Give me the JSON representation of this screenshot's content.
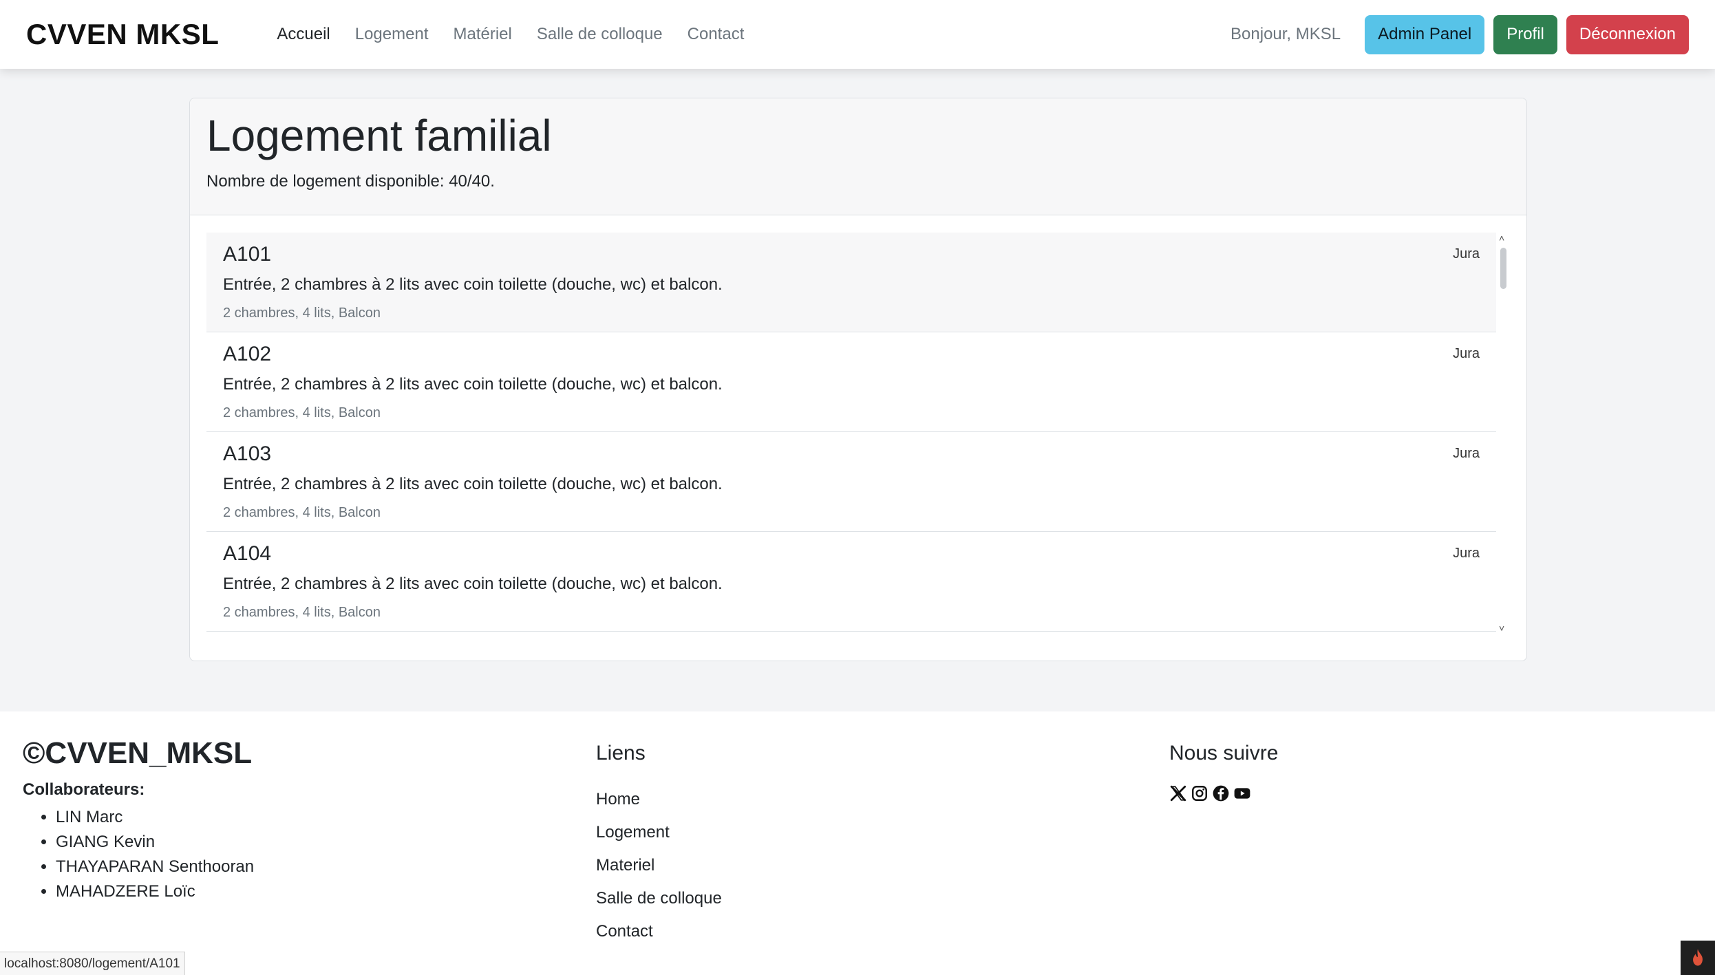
{
  "navbar": {
    "brand": "CVVEN MKSL",
    "links": [
      "Accueil",
      "Logement",
      "Matériel",
      "Salle de colloque",
      "Contact"
    ],
    "greeting": "Bonjour, MKSL",
    "admin_label": "Admin Panel",
    "profile_label": "Profil",
    "logout_label": "Déconnexion",
    "colors": {
      "admin": "#57c3e8",
      "profile": "#2f8050",
      "logout": "#d3414c"
    }
  },
  "main": {
    "title": "Logement familial",
    "availability": "Nombre de logement disponible: 40/40.",
    "items": [
      {
        "code": "A101",
        "description": "Entrée, 2 chambres à 2 lits avec coin toilette (douche, wc) et balcon.",
        "meta": "2 chambres, 4 lits, Balcon",
        "tag": "Jura"
      },
      {
        "code": "A102",
        "description": "Entrée, 2 chambres à 2 lits avec coin toilette (douche, wc) et balcon.",
        "meta": "2 chambres, 4 lits, Balcon",
        "tag": "Jura"
      },
      {
        "code": "A103",
        "description": "Entrée, 2 chambres à 2 lits avec coin toilette (douche, wc) et balcon.",
        "meta": "2 chambres, 4 lits, Balcon",
        "tag": "Jura"
      },
      {
        "code": "A104",
        "description": "Entrée, 2 chambres à 2 lits avec coin toilette (douche, wc) et balcon.",
        "meta": "2 chambres, 4 lits, Balcon",
        "tag": "Jura"
      }
    ]
  },
  "footer": {
    "brand": "©CVVEN_MKSL",
    "collaborators_title": "Collaborateurs:",
    "collaborators": [
      "LIN Marc",
      "GIANG Kevin",
      "THAYAPARAN Senthooran",
      "MAHADZERE Loïc"
    ],
    "links_title": "Liens",
    "links": [
      "Home",
      "Logement",
      "Materiel",
      "Salle de colloque",
      "Contact"
    ],
    "social_title": "Nous suivre",
    "social_icons": [
      "x-twitter-icon",
      "instagram-icon",
      "facebook-icon",
      "youtube-icon"
    ]
  },
  "status_url": "localhost:8080/logement/A101"
}
